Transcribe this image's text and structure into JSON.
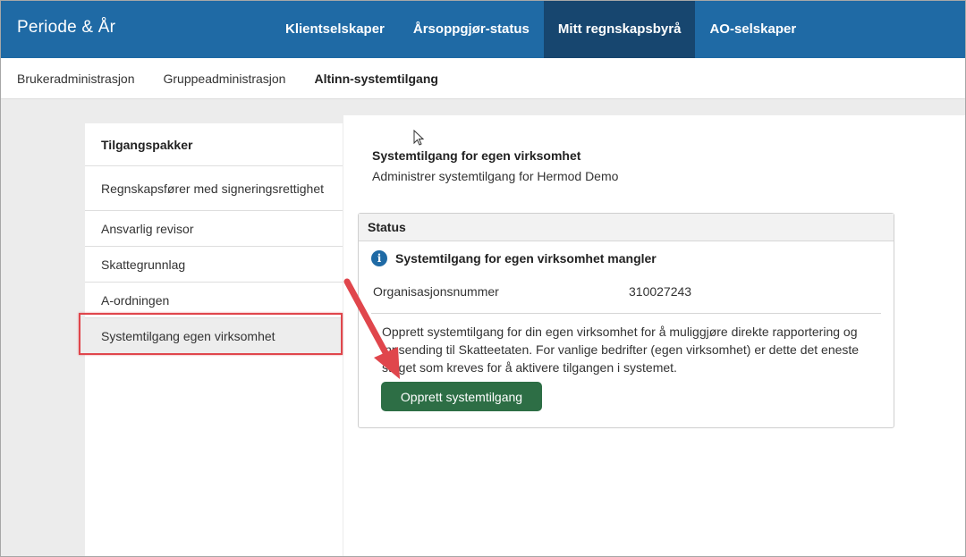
{
  "app": {
    "brand": "Periode & År"
  },
  "topnav": [
    {
      "label": "Klientselskaper",
      "active": false
    },
    {
      "label": "Årsoppgjør-status",
      "active": false
    },
    {
      "label": "Mitt regnskapsbyrå",
      "active": true
    },
    {
      "label": "AO-selskaper",
      "active": false
    }
  ],
  "subnav": [
    {
      "label": "Brukeradministrasjon",
      "active": false
    },
    {
      "label": "Gruppeadministrasjon",
      "active": false
    },
    {
      "label": "Altinn-systemtilgang",
      "active": true
    }
  ],
  "leftmenu": {
    "heading": "Tilgangspakker",
    "items": [
      {
        "label": "Regnskapsfører med signeringsrettighet"
      },
      {
        "label": "Ansvarlig revisor"
      },
      {
        "label": "Skattegrunnlag"
      },
      {
        "label": "A-ordningen"
      },
      {
        "label": "Systemtilgang egen virksomhet"
      }
    ]
  },
  "main": {
    "title": "Systemtilgang for egen virksomhet",
    "subtitle": "Administrer systemtilgang for Hermod Demo",
    "status": {
      "heading": "Status",
      "warning": "Systemtilgang for egen virksomhet mangler",
      "org_label": "Organisasjonsnummer",
      "org_value": "310027243",
      "description": "Opprett systemtilgang for din egen virksomhet for å muliggjøre direkte rapportering og innsending til Skatteetaten. For vanlige bedrifter (egen virksomhet) er dette det eneste steget som kreves for å aktivere tilgangen i systemet.",
      "button": "Opprett systemtilgang"
    }
  },
  "colors": {
    "topbar": "#1f6aa5",
    "topnav_active": "#17466f",
    "button": "#2d6e45",
    "annotation": "#e0464c",
    "info_icon": "#1f6aa5"
  }
}
